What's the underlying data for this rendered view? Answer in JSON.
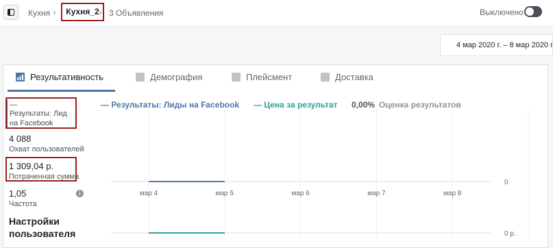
{
  "header": {
    "breadcrumb": [
      "Кухня",
      "Кухня_2",
      "3 Объявления"
    ],
    "toggle_label": "Выключено"
  },
  "date_range": "4 мар 2020 г. – 8 мар 2020 г.",
  "tabs": [
    {
      "label": "Результативность",
      "icon": "bar-chart-icon",
      "active": true
    },
    {
      "label": "Демография",
      "icon": "people-icon",
      "active": false
    },
    {
      "label": "Плейсмент",
      "icon": "placement-icon",
      "active": false
    },
    {
      "label": "Доставка",
      "icon": "delivery-chart-icon",
      "active": false
    }
  ],
  "metrics": [
    {
      "value": "—",
      "label": "Результаты: Лид на Facebook"
    },
    {
      "value": "4 088",
      "label": "Охват пользователей"
    },
    {
      "value": "1 309,04 р.",
      "label": "Потраченная сумма"
    },
    {
      "value": "1,05",
      "label": "Частота"
    }
  ],
  "settings_label": "Настройки пользователя",
  "legend": {
    "results": "— Результаты: Лиды на Facebook",
    "cost": "— Цена за результат",
    "rating_value": "0,00%",
    "rating_label": "Оценка результатов"
  },
  "colors": {
    "results": "#4a76a8",
    "cost": "#2aa198",
    "accent": "#4267b2",
    "highlight": "#9b1c1c"
  },
  "chart_data": {
    "type": "line",
    "categories": [
      "мар 4",
      "мар 5",
      "мар 6",
      "мар 7",
      "мар 8"
    ],
    "series": [
      {
        "name": "Результаты: Лиды на Facebook",
        "values": [
          0,
          0
        ],
        "x_span": [
          "мар 4",
          "мар 5"
        ]
      },
      {
        "name": "Цена за результат",
        "values": [
          0,
          0
        ],
        "x_span": [
          "мар 4",
          "мар 5"
        ]
      }
    ],
    "y_labels": [
      "0",
      "0 р."
    ],
    "grid": true
  }
}
